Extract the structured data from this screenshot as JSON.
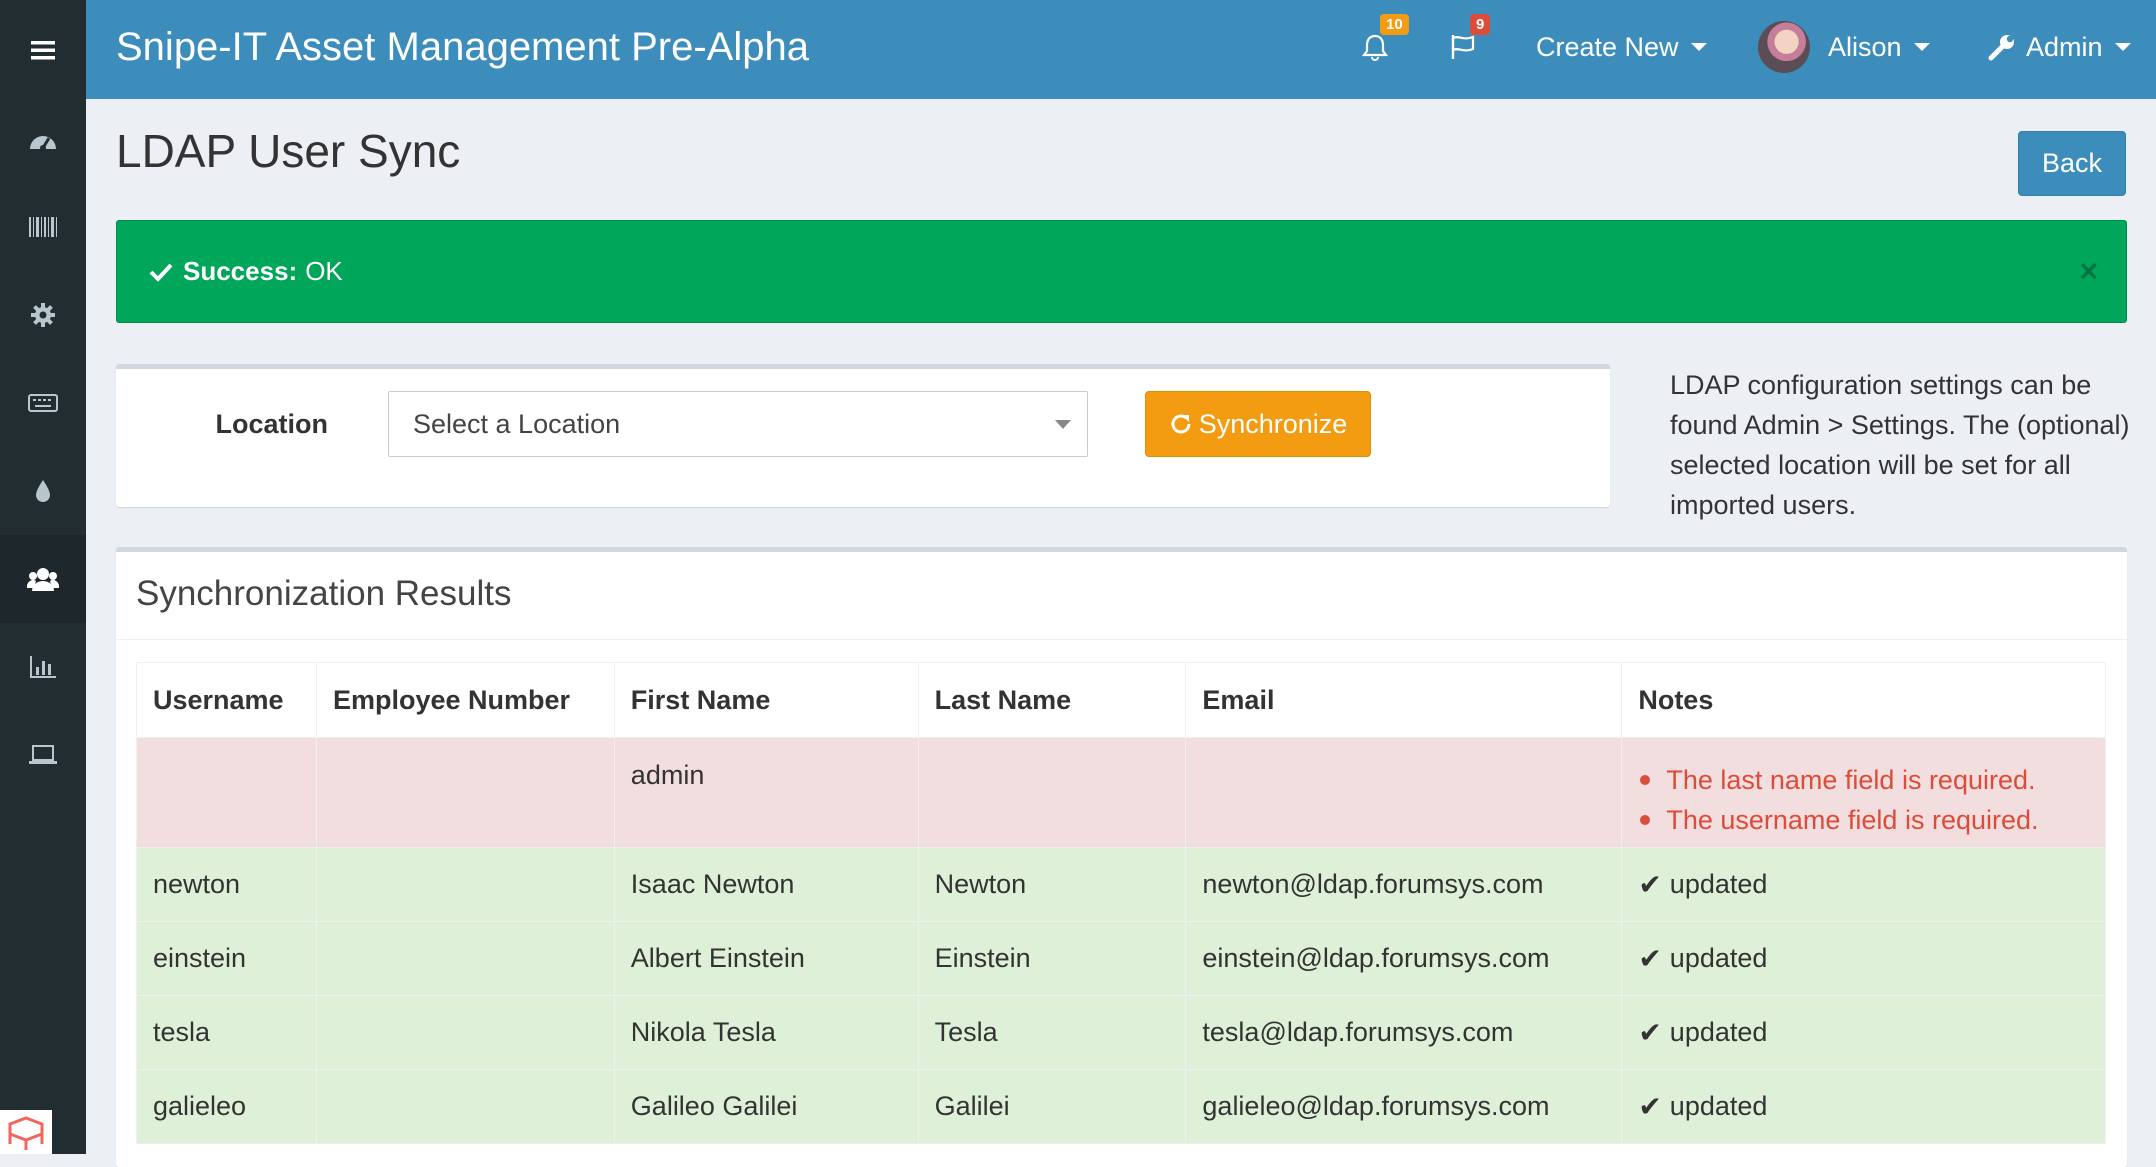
{
  "header": {
    "brand": "Snipe-IT Asset Management Pre-Alpha",
    "alerts_count": "10",
    "requests_count": "9",
    "create_new_label": "Create New",
    "user_name": "Alison",
    "admin_label": "Admin",
    "colors": {
      "header_bg": "#3c8dbc",
      "badge_alerts": "#f39c12",
      "badge_requests": "#dd4b39"
    }
  },
  "sidebar": {
    "items": [
      {
        "icon": "dashboard-icon"
      },
      {
        "icon": "barcode-icon"
      },
      {
        "icon": "gear-icon"
      },
      {
        "icon": "keyboard-icon"
      },
      {
        "icon": "tint-icon"
      },
      {
        "icon": "users-icon",
        "active": true
      },
      {
        "icon": "bar-chart-icon"
      },
      {
        "icon": "laptop-icon"
      }
    ]
  },
  "page": {
    "title": "LDAP User Sync",
    "back_label": "Back"
  },
  "alert": {
    "label": "Success:",
    "message": "OK",
    "close_symbol": "×"
  },
  "form": {
    "location_label": "Location",
    "location_placeholder": "Select a Location",
    "sync_label": "Synchronize",
    "help_text": "LDAP configuration settings can be found Admin > Settings. The (optional) selected location will be set for all imported users."
  },
  "results": {
    "title": "Synchronization Results",
    "columns": [
      "Username",
      "Employee Number",
      "First Name",
      "Last Name",
      "Email",
      "Notes"
    ],
    "rows": [
      {
        "status": "error",
        "username": "",
        "employee_number": "",
        "first_name": "admin",
        "last_name": "",
        "email": "",
        "notes": [
          "The last name field is required.",
          "The username field is required."
        ]
      },
      {
        "status": "ok",
        "username": "newton",
        "employee_number": "",
        "first_name": "Isaac Newton",
        "last_name": "Newton",
        "email": "newton@ldap.forumsys.com",
        "note": "updated"
      },
      {
        "status": "ok",
        "username": "einstein",
        "employee_number": "",
        "first_name": "Albert Einstein",
        "last_name": "Einstein",
        "email": "einstein@ldap.forumsys.com",
        "note": "updated"
      },
      {
        "status": "ok",
        "username": "tesla",
        "employee_number": "",
        "first_name": "Nikola Tesla",
        "last_name": "Tesla",
        "email": "tesla@ldap.forumsys.com",
        "note": "updated"
      },
      {
        "status": "ok",
        "username": "galieleo",
        "employee_number": "",
        "first_name": "Galileo Galilei",
        "last_name": "Galilei",
        "email": "galieleo@ldap.forumsys.com",
        "note": "updated"
      }
    ]
  }
}
